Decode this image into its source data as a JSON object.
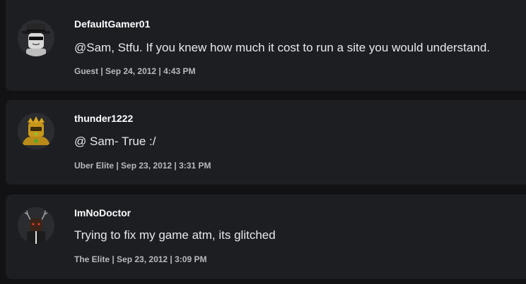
{
  "comments": [
    {
      "username": "DefaultGamer01",
      "text": "@Sam, Stfu. If you knew how much it cost to run a site you would understand.",
      "rank": "Guest",
      "timestamp": "Sep 24, 2012 | 4:43 PM",
      "meta": "Guest | Sep 24, 2012 | 4:43 PM",
      "avatar_icon": "avatar-fedora-sunglasses-icon"
    },
    {
      "username": "thunder1222",
      "text": "@ Sam- True :/",
      "rank": "Uber Elite",
      "timestamp": "Sep 23, 2012 | 3:31 PM",
      "meta": "Uber Elite | Sep 23, 2012 | 3:31 PM",
      "avatar_icon": "avatar-golden-crown-icon"
    },
    {
      "username": "ImNoDoctor",
      "text": "Trying to fix my game atm, its glitched",
      "rank": "The Elite",
      "timestamp": "Sep 23, 2012 | 3:09 PM",
      "meta": "The Elite | Sep 23, 2012 | 3:09 PM",
      "avatar_icon": "avatar-antlers-icon"
    }
  ],
  "colors": {
    "page_background": "#121215",
    "card_background": "#1d1e21",
    "username": "#ffffff",
    "body_text": "#e8e8ea",
    "meta_text": "#b8b9bd"
  }
}
